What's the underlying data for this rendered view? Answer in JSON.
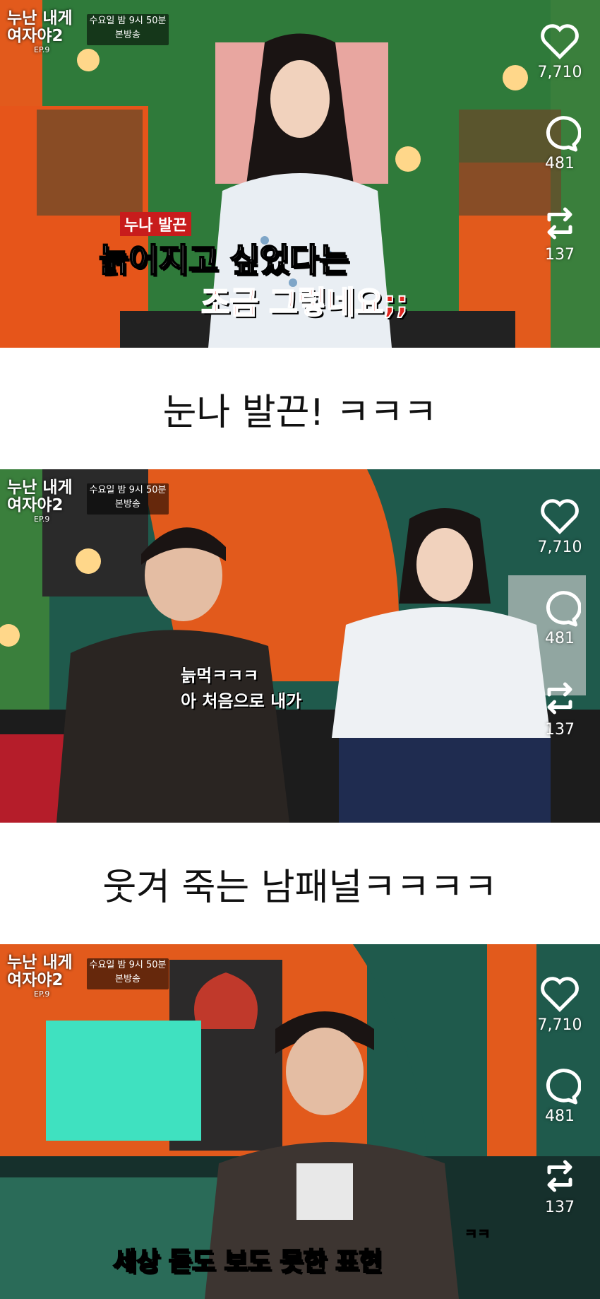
{
  "overlay": {
    "show_title_line1": "누난 내게",
    "show_title_line2": "여자야2",
    "episode": "EP.9",
    "air_time": "수요일 밤 9시 50분",
    "air_note": "본방송"
  },
  "actions": {
    "likes": "7,710",
    "comments": "481",
    "reposts": "137"
  },
  "frames": [
    {
      "subtitle_small": "누나 발끈",
      "subtitle_line1": "늙어지고 싶었다는",
      "subtitle_line2": "조금 그렇네요;;"
    },
    {
      "subtitle_line1": "늙먹ㅋㅋㅋ",
      "subtitle_line2": "아 처음으로 내가"
    },
    {
      "subtitle_line1": "세상 듣도 보도 못한 표현",
      "subtitle_tag": "ㅋㅋ"
    }
  ],
  "captions": [
    "눈나 발끈! ㅋㅋㅋ",
    "웃겨 죽는 남패널ㅋㅋㅋㅋ"
  ],
  "colors": {
    "accent_red": "#e0261f",
    "subtitle_yellow": "#ffe24a",
    "stage_orange": "#e25a1c",
    "stage_green": "#2f7a3a",
    "stage_teal": "#1f5a4c"
  },
  "icons": [
    "heart-icon",
    "comment-icon",
    "repost-icon"
  ]
}
